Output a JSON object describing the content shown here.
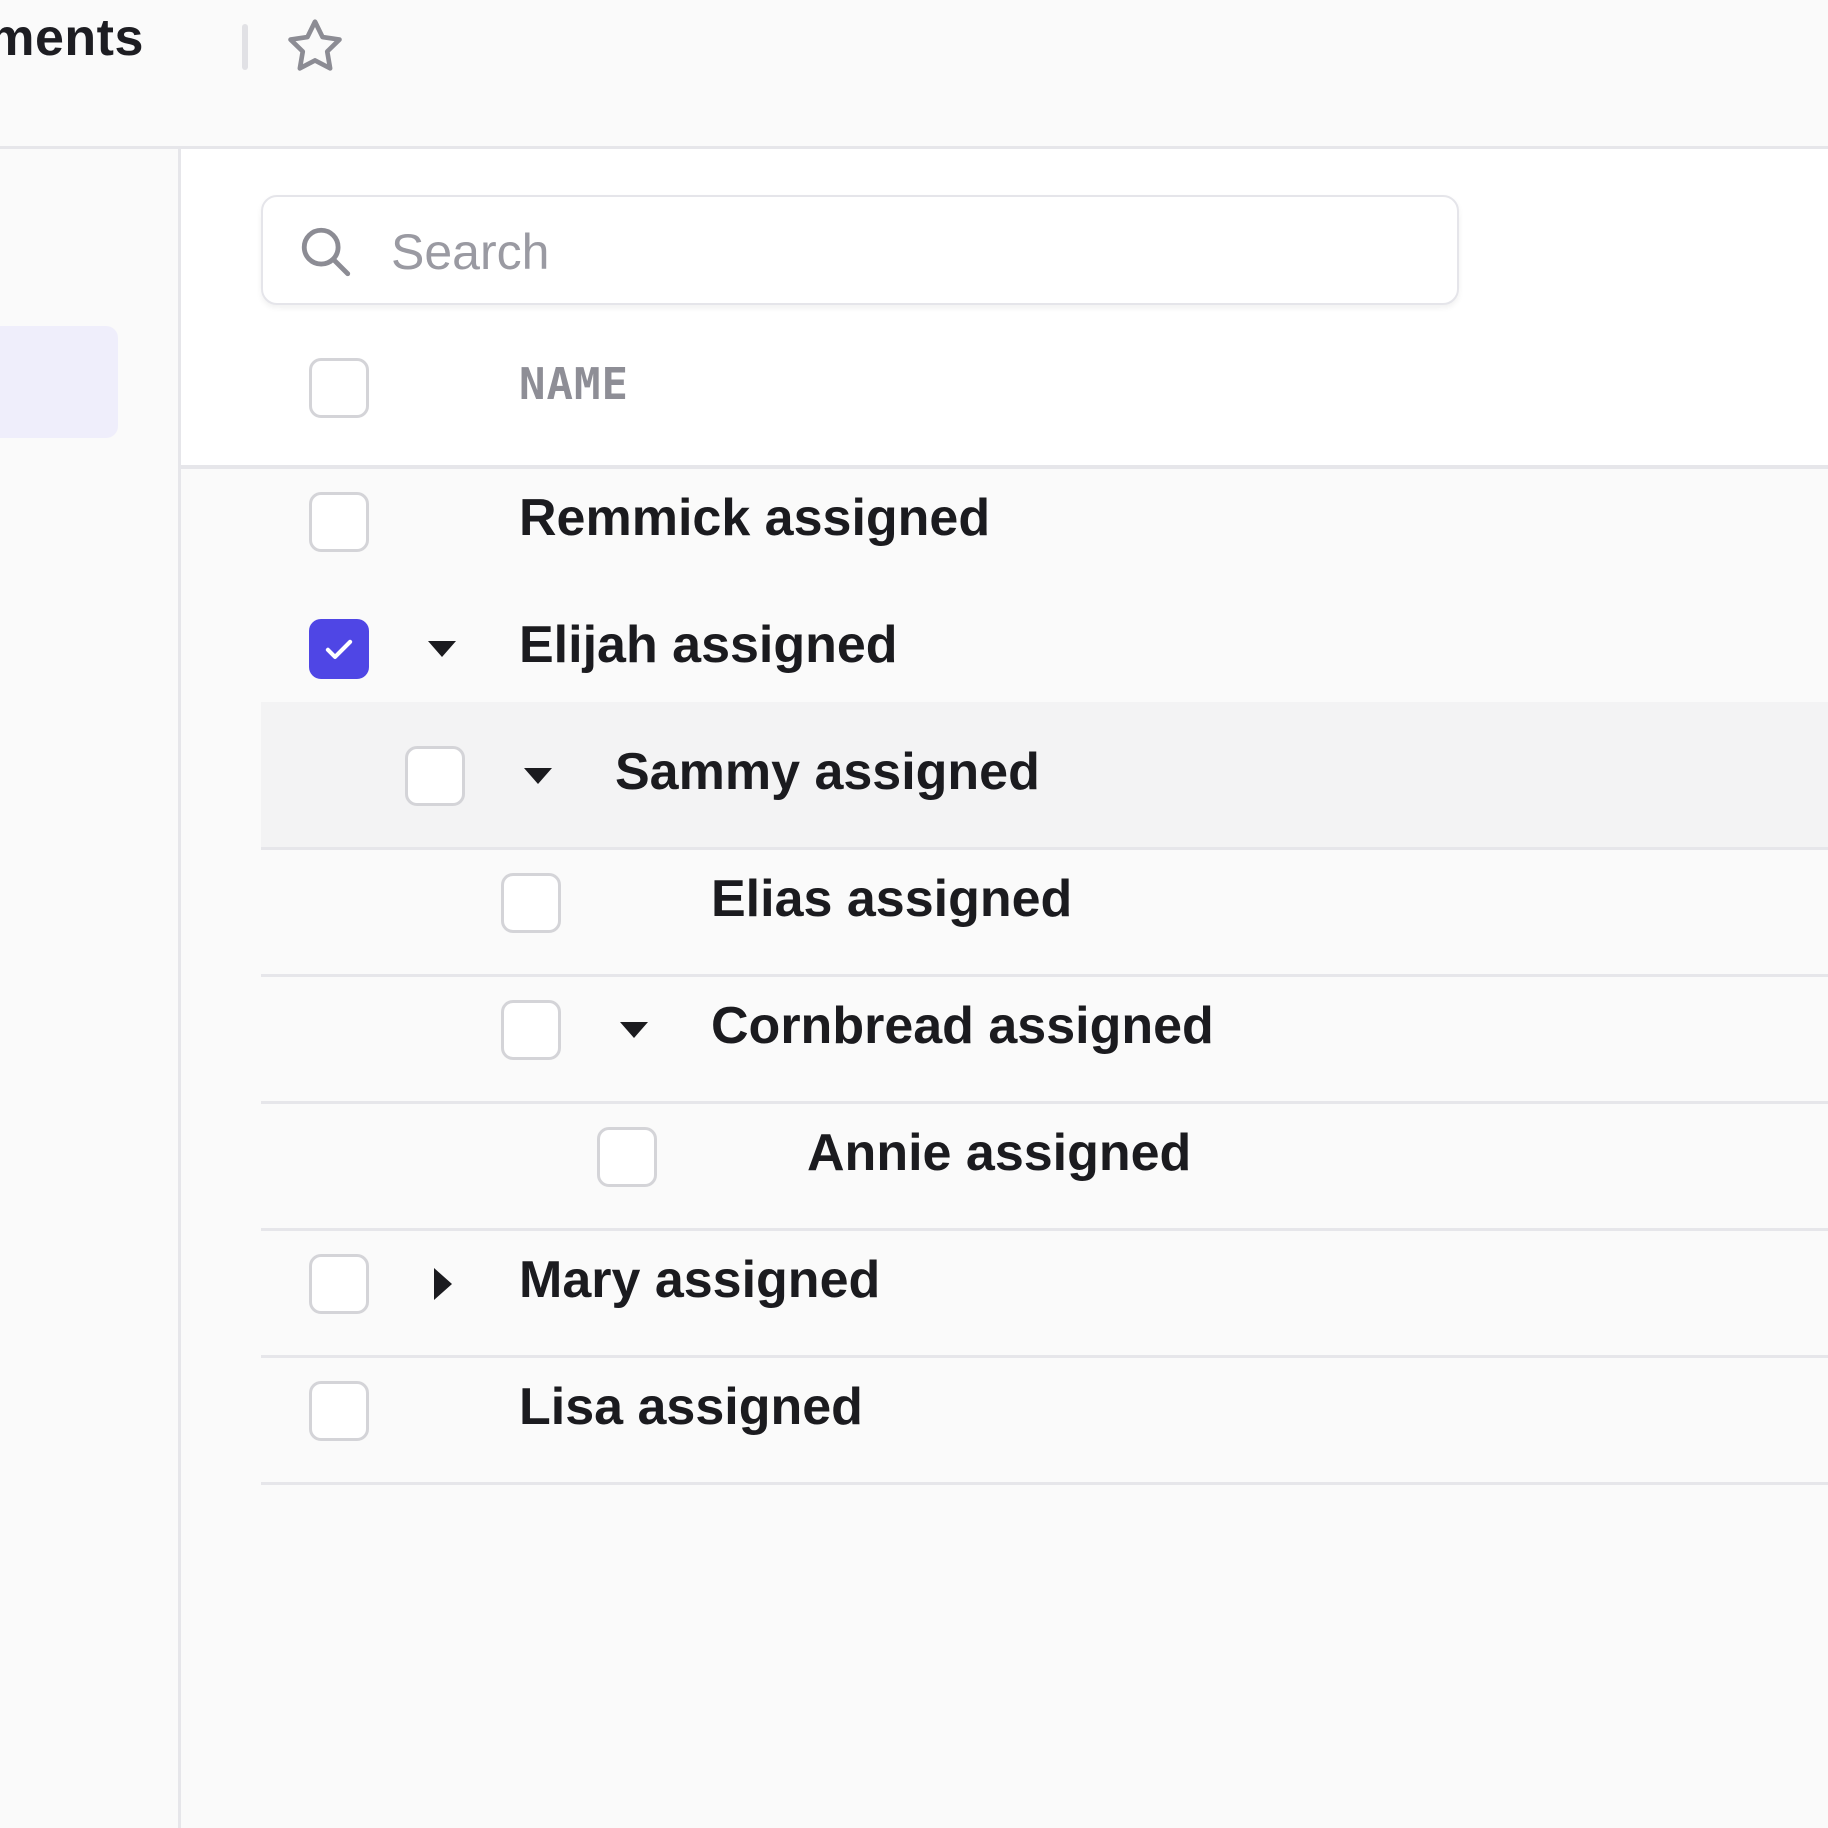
{
  "header": {
    "title": "gments"
  },
  "search": {
    "placeholder": "Search",
    "value": ""
  },
  "table": {
    "column_header": "NAME",
    "rows": [
      {
        "label": "Remmick assigned",
        "level": 0,
        "checked": false,
        "toggle": "none"
      },
      {
        "label": "Elijah assigned",
        "level": 0,
        "checked": true,
        "toggle": "expanded"
      },
      {
        "label": "Sammy assigned",
        "level": 1,
        "checked": false,
        "toggle": "expanded",
        "hovered": true
      },
      {
        "label": "Elias assigned",
        "level": 2,
        "checked": false,
        "toggle": "none"
      },
      {
        "label": "Cornbread assigned",
        "level": 2,
        "checked": false,
        "toggle": "expanded"
      },
      {
        "label": "Annie assigned",
        "level": 3,
        "checked": false,
        "toggle": "none"
      },
      {
        "label": "Mary assigned",
        "level": 0,
        "checked": false,
        "toggle": "collapsed"
      },
      {
        "label": "Lisa assigned",
        "level": 0,
        "checked": false,
        "toggle": "none"
      }
    ]
  },
  "colors": {
    "accent": "#4f46e5",
    "sidebar_active": "#efeefb",
    "border": "#e6e6ea",
    "text": "#1b1b1f",
    "muted": "#8e8e96"
  },
  "icons": {
    "star": "star-icon",
    "search": "search-icon",
    "check": "check-icon",
    "expanded": "caret-down-icon",
    "collapsed": "caret-right-icon"
  }
}
